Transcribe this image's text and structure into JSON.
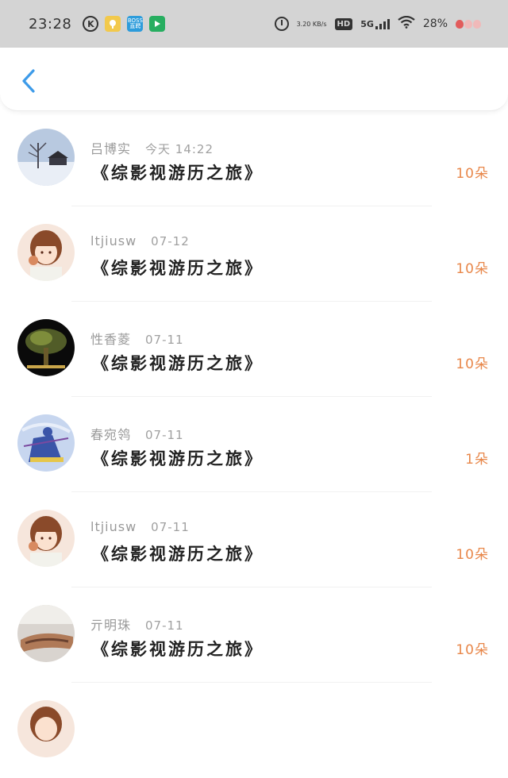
{
  "status_bar": {
    "time": "23:28",
    "k_icon_label": "K",
    "app1_label": "",
    "app2_label": "BOSS 直聘",
    "app3_label": "",
    "network_speed": "3.20 KB/s",
    "hd_label": "HD",
    "signal_label": "5G",
    "battery": "28%"
  },
  "header": {
    "back_icon": "chevron-left-icon"
  },
  "rows": [
    {
      "name": "吕博实",
      "date": "今天 14:22",
      "title": "《综影视游历之旅》",
      "amount": "10朵",
      "avatar": "winter-house"
    },
    {
      "name": "ltjiusw",
      "date": "07-12",
      "title": "《综影视游历之旅》",
      "amount": "10朵",
      "avatar": "anime-girl"
    },
    {
      "name": "性香菱",
      "date": "07-11",
      "title": "《综影视游历之旅》",
      "amount": "10朵",
      "avatar": "night-tree"
    },
    {
      "name": "春宛鸰",
      "date": "07-11",
      "title": "《综影视游历之旅》",
      "amount": "1朵",
      "avatar": "blue-dancer"
    },
    {
      "name": "ltjiusw",
      "date": "07-11",
      "title": "《综影视游历之旅》",
      "amount": "10朵",
      "avatar": "anime-girl"
    },
    {
      "name": "亓明珠",
      "date": "07-11",
      "title": "《综影视游历之旅》",
      "amount": "10朵",
      "avatar": "hand-photo"
    },
    {
      "name": "",
      "date": "",
      "title": "",
      "amount": "",
      "avatar": "anime-girl"
    }
  ],
  "colors": {
    "accent": "#e8874a",
    "back_arrow": "#3d9be9",
    "status_bg": "#d4d4d4"
  }
}
